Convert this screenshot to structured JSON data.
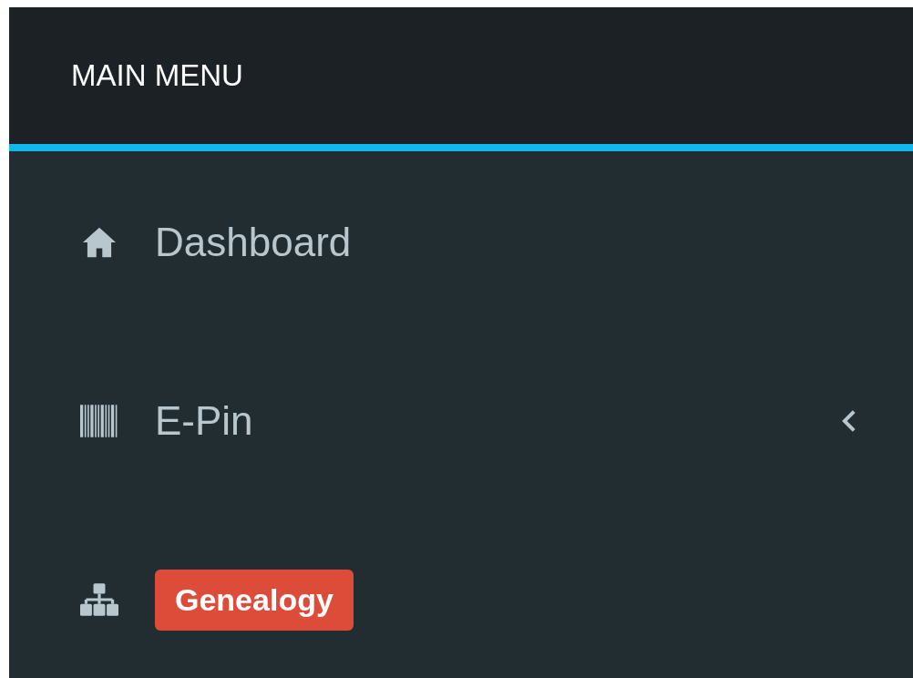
{
  "header": {
    "title": "MAIN MENU"
  },
  "menu_items": [
    {
      "kind": "link",
      "label": "Dashboard",
      "expandable": false
    },
    {
      "kind": "link",
      "label": "E-Pin",
      "expandable": true
    },
    {
      "kind": "badge",
      "label": "Genealogy",
      "expandable": false
    }
  ]
}
